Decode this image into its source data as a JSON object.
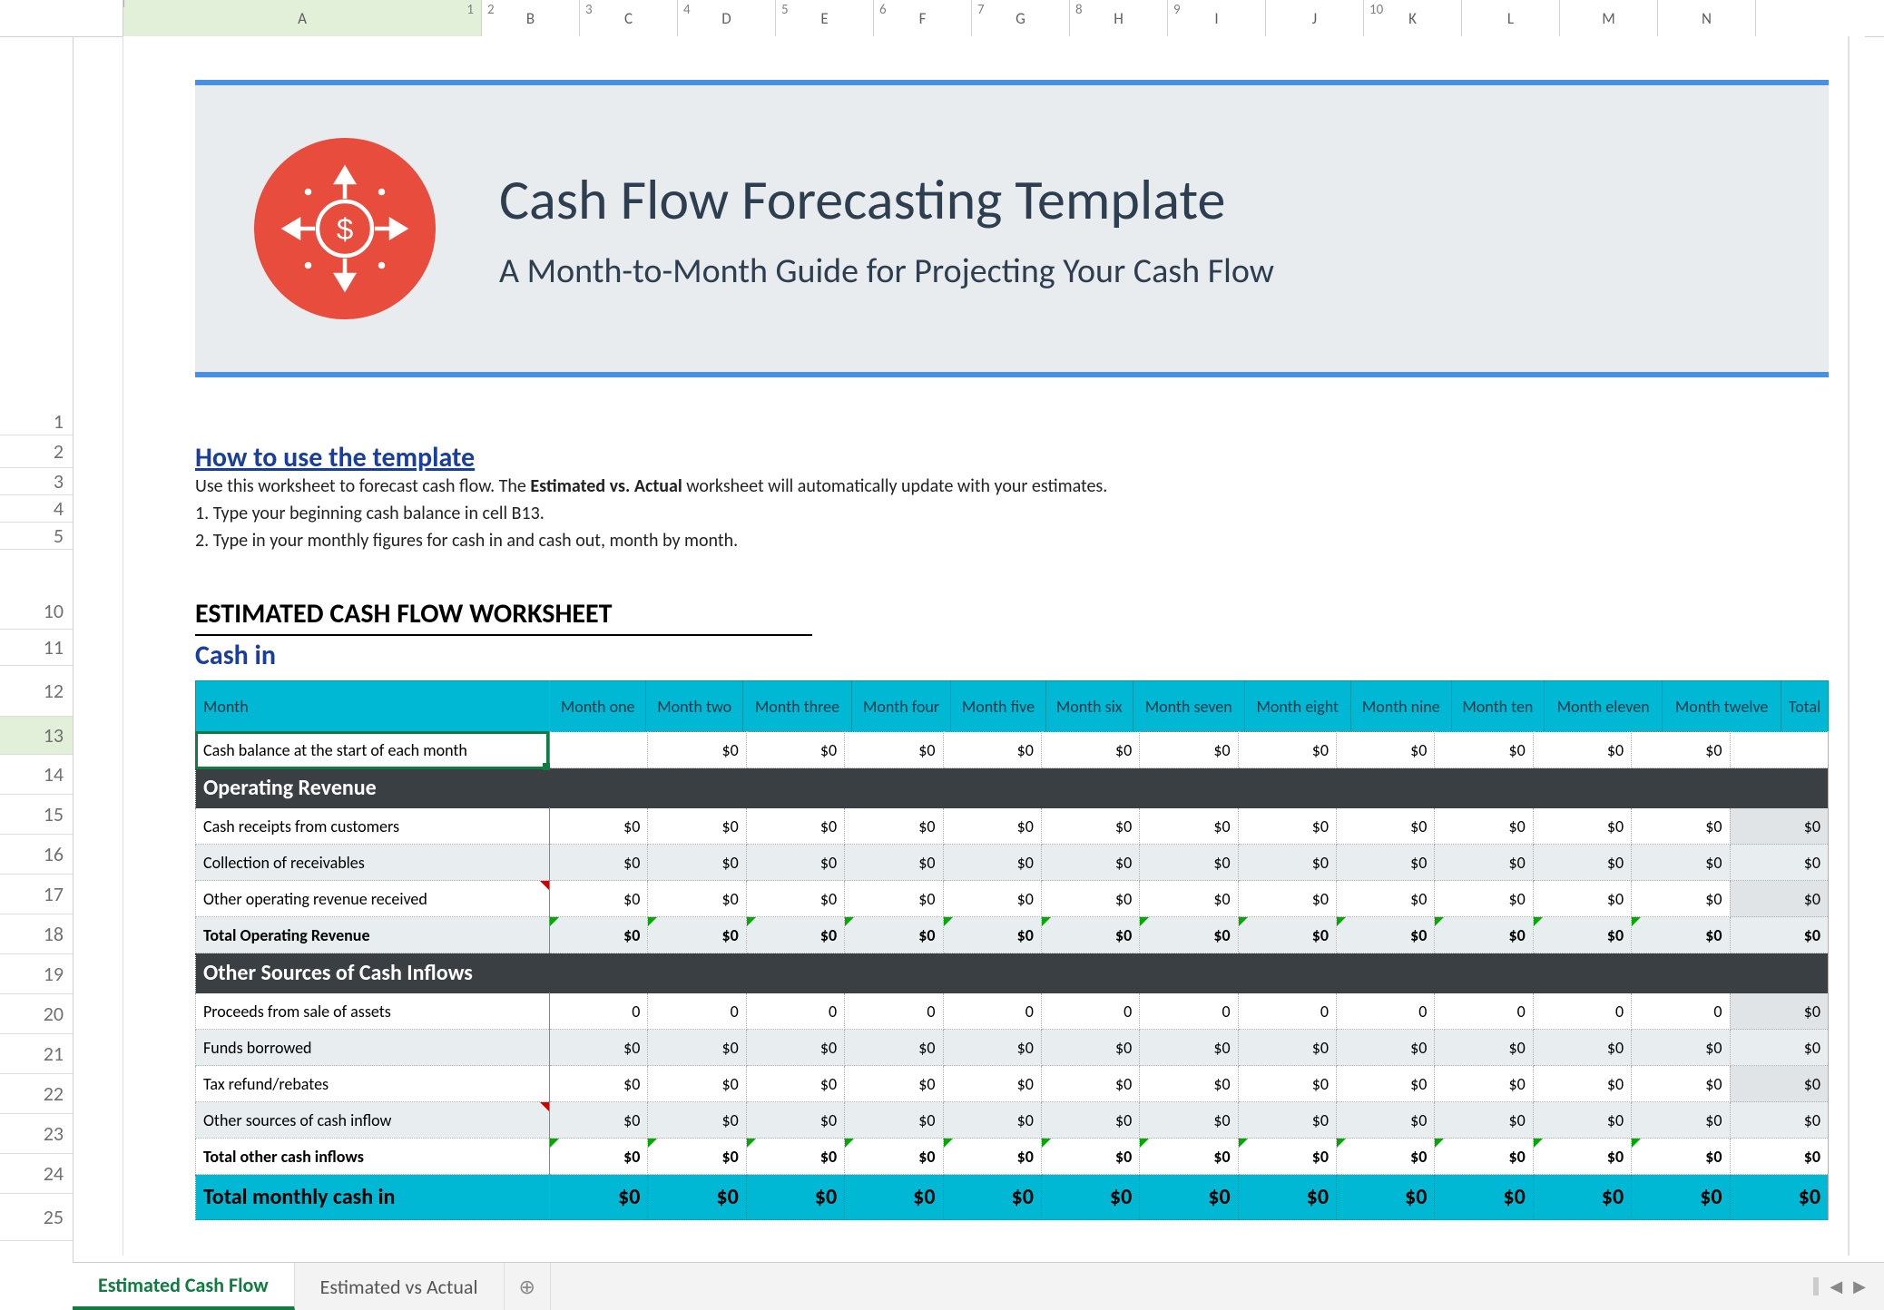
{
  "column_ruler": {
    "numbers": [
      "1",
      "2",
      "3",
      "4",
      "5",
      "6",
      "7",
      "8",
      "9",
      "10"
    ],
    "letters": [
      "A",
      "B",
      "C",
      "D",
      "E",
      "F",
      "G",
      "H",
      "I",
      "J",
      "K",
      "L",
      "M",
      "N"
    ]
  },
  "row_numbers": [
    "1",
    "2",
    "3",
    "4",
    "5",
    "10",
    "11",
    "12",
    "13",
    "14",
    "15",
    "16",
    "17",
    "18",
    "19",
    "20",
    "21",
    "22",
    "23",
    "24",
    "25"
  ],
  "banner": {
    "title": "Cash Flow Forecasting Template",
    "subtitle": "A Month-to-Month Guide for Projecting Your Cash Flow"
  },
  "instructions": {
    "howto_title": "How to use the template",
    "line_intro_pre": "Use this worksheet to forecast cash flow. The ",
    "line_intro_bold": "Estimated vs. Actual",
    "line_intro_post": " worksheet will automatically update with your estimates.",
    "step1": "1. Type your beginning cash balance in cell B13.",
    "step2": "2. Type in your monthly figures for cash in and cash out, month by month."
  },
  "sheet_heading": "ESTIMATED CASH FLOW WORKSHEET",
  "cashin_heading": "Cash in",
  "months_label": "Month",
  "months": [
    "Month one",
    "Month two",
    "Month three",
    "Month four",
    "Month five",
    "Month six",
    "Month seven",
    "Month eight",
    "Month nine",
    "Month ten",
    "Month eleven",
    "Month twelve"
  ],
  "total_label": "Total",
  "rows": {
    "start_balance": {
      "label": "Cash balance at the start of each month",
      "cells": [
        "",
        "$0",
        "$0",
        "$0",
        "$0",
        "$0",
        "$0",
        "$0",
        "$0",
        "$0",
        "$0",
        "$0"
      ],
      "total": ""
    },
    "operating_revenue_head": "Operating Revenue",
    "r_cash_receipts": {
      "label": "Cash receipts from customers",
      "cells": [
        "$0",
        "$0",
        "$0",
        "$0",
        "$0",
        "$0",
        "$0",
        "$0",
        "$0",
        "$0",
        "$0",
        "$0"
      ],
      "total": "$0"
    },
    "r_collection": {
      "label": "Collection of receivables",
      "cells": [
        "$0",
        "$0",
        "$0",
        "$0",
        "$0",
        "$0",
        "$0",
        "$0",
        "$0",
        "$0",
        "$0",
        "$0"
      ],
      "total": "$0"
    },
    "r_other_op": {
      "label": "Other operating revenue received",
      "cells": [
        "$0",
        "$0",
        "$0",
        "$0",
        "$0",
        "$0",
        "$0",
        "$0",
        "$0",
        "$0",
        "$0",
        "$0"
      ],
      "total": "$0"
    },
    "r_total_op": {
      "label": "Total Operating Revenue",
      "cells": [
        "$0",
        "$0",
        "$0",
        "$0",
        "$0",
        "$0",
        "$0",
        "$0",
        "$0",
        "$0",
        "$0",
        "$0"
      ],
      "total": "$0"
    },
    "other_sources_head": "Other Sources of Cash Inflows",
    "r_sale_assets": {
      "label": "Proceeds from sale of assets",
      "cells": [
        "0",
        "0",
        "0",
        "0",
        "0",
        "0",
        "0",
        "0",
        "0",
        "0",
        "0",
        "0"
      ],
      "total": "$0"
    },
    "r_borrowed": {
      "label": "Funds borrowed",
      "cells": [
        "$0",
        "$0",
        "$0",
        "$0",
        "$0",
        "$0",
        "$0",
        "$0",
        "$0",
        "$0",
        "$0",
        "$0"
      ],
      "total": "$0"
    },
    "r_tax_refund": {
      "label": "Tax refund/rebates",
      "cells": [
        "$0",
        "$0",
        "$0",
        "$0",
        "$0",
        "$0",
        "$0",
        "$0",
        "$0",
        "$0",
        "$0",
        "$0"
      ],
      "total": "$0"
    },
    "r_other_inflow": {
      "label": "Other sources of cash inflow",
      "cells": [
        "$0",
        "$0",
        "$0",
        "$0",
        "$0",
        "$0",
        "$0",
        "$0",
        "$0",
        "$0",
        "$0",
        "$0"
      ],
      "total": "$0"
    },
    "r_total_other": {
      "label": "Total other cash inflows",
      "cells": [
        "$0",
        "$0",
        "$0",
        "$0",
        "$0",
        "$0",
        "$0",
        "$0",
        "$0",
        "$0",
        "$0",
        "$0"
      ],
      "total": "$0"
    },
    "r_grand": {
      "label": "Total monthly cash in",
      "cells": [
        "$0",
        "$0",
        "$0",
        "$0",
        "$0",
        "$0",
        "$0",
        "$0",
        "$0",
        "$0",
        "$0",
        "$0"
      ],
      "total": "$0"
    }
  },
  "tabs": [
    "Estimated Cash Flow",
    "Estimated vs Actual"
  ],
  "active_tab": 0,
  "selected_cell": "A13"
}
